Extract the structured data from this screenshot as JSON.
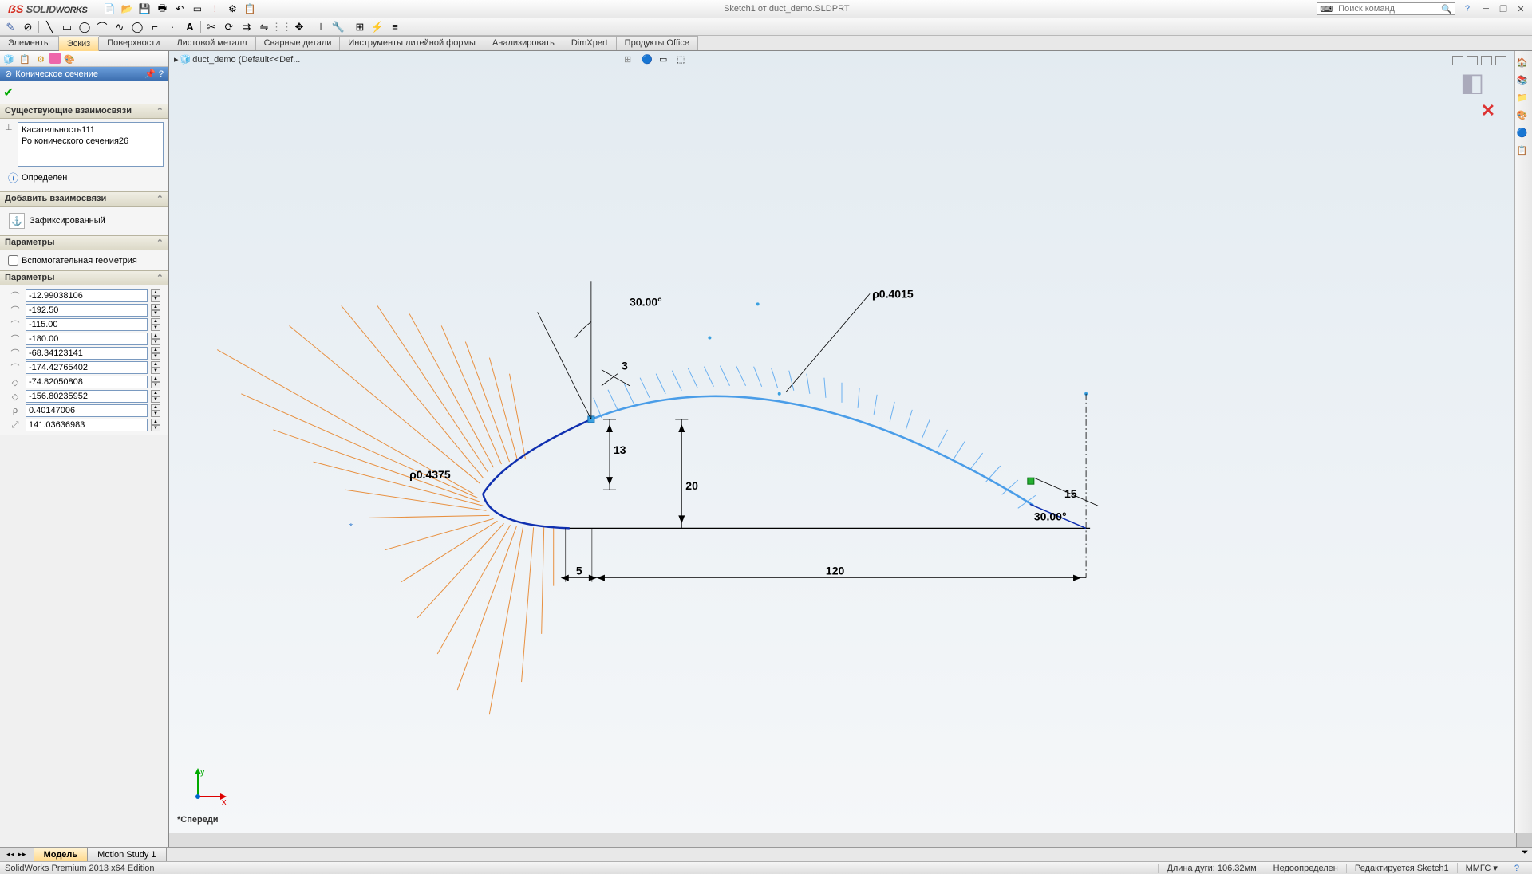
{
  "titlebar": {
    "title": "Sketch1 от duct_demo.SLDPRT",
    "search_placeholder": "Поиск команд"
  },
  "cm_tabs": [
    "Элементы",
    "Эскиз",
    "Поверхности",
    "Листовой металл",
    "Сварные детали",
    "Инструменты литейной формы",
    "Анализировать",
    "DimXpert",
    "Продукты Office"
  ],
  "cm_active": 1,
  "pm": {
    "title": "Коническое сечение",
    "sec_existing": "Существующие взаимосвязи",
    "relations": [
      "Касательность111",
      "Ро конического сечения26"
    ],
    "status_label": "Определен",
    "sec_add": "Добавить взаимосвязи",
    "btn_fixed": "Зафиксированный",
    "sec_params1": "Параметры",
    "chk_construction": "Вспомогательная геометрия",
    "sec_params2": "Параметры",
    "params": [
      "-12.99038106",
      "-192.50",
      "-115.00",
      "-180.00",
      "-68.34123141",
      "-174.42765402",
      "-74.82050808",
      "-156.80235952",
      "0.40147006",
      "141.03636983"
    ]
  },
  "tree": {
    "node": "duct_demo  (Default<<Def..."
  },
  "dims": {
    "rho1": "ρ0.4375",
    "rho2": "ρ0.4015",
    "a30_1": "30.00°",
    "a30_2": "30.00°",
    "d3": "3",
    "d13": "13",
    "d20": "20",
    "d5": "5",
    "d120": "120",
    "d15": "15"
  },
  "view_label": "*Спереди",
  "bottom_tabs": [
    "Модель",
    "Motion Study 1"
  ],
  "status": {
    "version": "SolidWorks Premium 2013 x64 Edition",
    "arc_len": "Длина дуги: 106.32мм",
    "defined": "Недоопределен",
    "editing": "Редактируется Sketch1",
    "units": "ММГС"
  },
  "triad": {
    "x": "x",
    "y": "y"
  }
}
